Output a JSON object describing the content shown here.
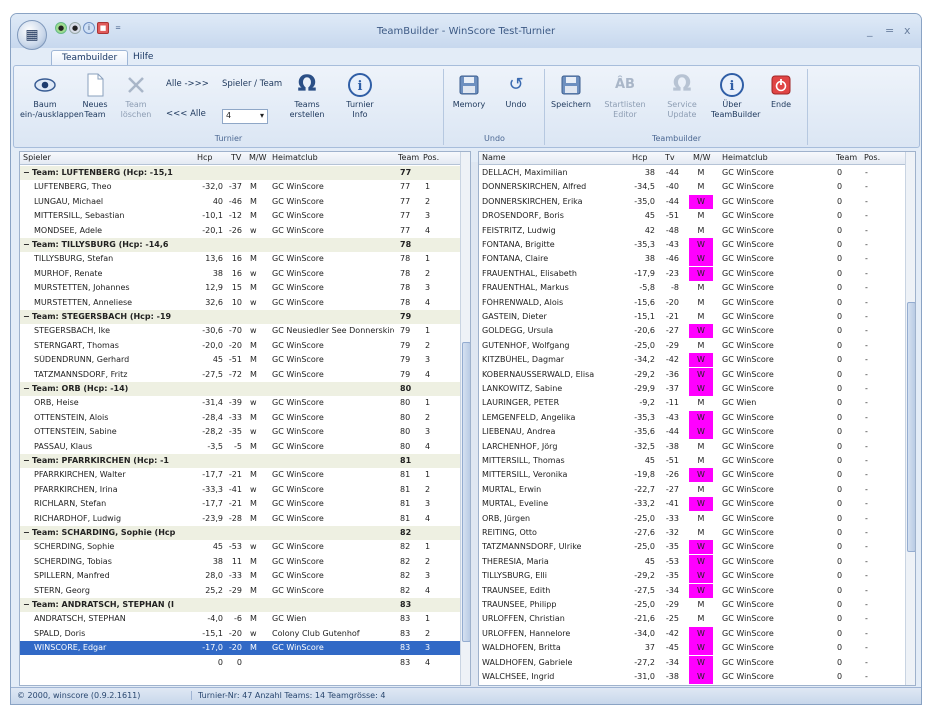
{
  "window": {
    "title": "TeamBuilder - WinScore Test-Turnier",
    "min": "_",
    "max": "=",
    "close": "x",
    "qa_drop": "="
  },
  "tabs": [
    {
      "label": "Teambuilder"
    },
    {
      "label": "Hilfe"
    }
  ],
  "ribbon": {
    "turnier": {
      "label": "Turnier",
      "baum": "Baum\nein-/ausklappen",
      "neues": "Neues\nTeam",
      "loeschen": "Team\nlöschen",
      "alle_vor": "Alle ->>>",
      "alle_zur": "<<< Alle",
      "spieler_team_label": "Spieler / Team",
      "spieler_team_value": "4",
      "teams_erstellen": "Teams\nerstellen",
      "turnier_info": "Turnier\nInfo"
    },
    "undo": {
      "label": "Undo",
      "memory": "Memory",
      "undo": "Undo"
    },
    "tb": {
      "label": "Teambuilder",
      "speichern": "Speichern",
      "startlisten": "Startlisten\nEditor",
      "service": "Service\nUpdate",
      "ueber": "Über\nTeamBuilder",
      "ende": "Ende"
    }
  },
  "left": {
    "headers": [
      "Spieler",
      "Hcp",
      "TV",
      "M/W",
      "Heimatclub",
      "Team",
      "Pos."
    ],
    "rows": [
      {
        "g": true,
        "name": "Team: LUFTENBERG (Hcp: -15,1",
        "team": "77"
      },
      {
        "name": "LUFTENBERG, Theo",
        "hcp": "-32,0",
        "tv": "-37",
        "mw": "M",
        "club": "GC WinScore",
        "team": "77",
        "pos": "1"
      },
      {
        "name": "LUNGAU, Michael",
        "hcp": "40",
        "tv": "-46",
        "mw": "M",
        "club": "GC WinScore",
        "team": "77",
        "pos": "2"
      },
      {
        "name": "MITTERSILL, Sebastian",
        "hcp": "-10,1",
        "tv": "-12",
        "mw": "M",
        "club": "GC WinScore",
        "team": "77",
        "pos": "3"
      },
      {
        "name": "MONDSEE, Adele",
        "hcp": "-20,1",
        "tv": "-26",
        "mw": "w",
        "club": "GC WinScore",
        "team": "77",
        "pos": "4"
      },
      {
        "g": true,
        "name": "Team: TILLYSBURG (Hcp: -14,6",
        "team": "78"
      },
      {
        "name": "TILLYSBURG, Stefan",
        "hcp": "13,6",
        "tv": "16",
        "mw": "M",
        "club": "GC WinScore",
        "team": "78",
        "pos": "1"
      },
      {
        "name": "MURHOF, Renate",
        "hcp": "38",
        "tv": "16",
        "mw": "w",
        "club": "GC WinScore",
        "team": "78",
        "pos": "2"
      },
      {
        "name": "MURSTETTEN, Johannes",
        "hcp": "12,9",
        "tv": "15",
        "mw": "M",
        "club": "GC WinScore",
        "team": "78",
        "pos": "3"
      },
      {
        "name": "MURSTETTEN, Anneliese",
        "hcp": "32,6",
        "tv": "10",
        "mw": "w",
        "club": "GC WinScore",
        "team": "78",
        "pos": "4"
      },
      {
        "g": true,
        "name": "Team: STEGERSBACH (Hcp: -19",
        "team": "79"
      },
      {
        "name": "STEGERSBACH, Ike",
        "hcp": "-30,6",
        "tv": "-70",
        "mw": "w",
        "club": "GC Neusiedler See Donnerskirchen",
        "team": "79",
        "pos": "1"
      },
      {
        "name": "STERNGART, Thomas",
        "hcp": "-20,0",
        "tv": "-20",
        "mw": "M",
        "club": "GC WinScore",
        "team": "79",
        "pos": "2"
      },
      {
        "name": "SÜDENDRUNN, Gerhard",
        "hcp": "45",
        "tv": "-51",
        "mw": "M",
        "club": "GC WinScore",
        "team": "79",
        "pos": "3"
      },
      {
        "name": "TATZMANNSDORF, Fritz",
        "hcp": "-27,5",
        "tv": "-72",
        "mw": "M",
        "club": "GC WinScore",
        "team": "79",
        "pos": "4"
      },
      {
        "g": true,
        "name": "Team: ORB (Hcp: -14)",
        "team": "80"
      },
      {
        "name": "ORB, Heise",
        "hcp": "-31,4",
        "tv": "-39",
        "mw": "w",
        "club": "GC WinScore",
        "team": "80",
        "pos": "1"
      },
      {
        "name": "OTTENSTEIN, Alois",
        "hcp": "-28,4",
        "tv": "-33",
        "mw": "M",
        "club": "GC WinScore",
        "team": "80",
        "pos": "2"
      },
      {
        "name": "OTTENSTEIN, Sabine",
        "hcp": "-28,2",
        "tv": "-35",
        "mw": "w",
        "club": "GC WinScore",
        "team": "80",
        "pos": "3"
      },
      {
        "name": "PASSAU, Klaus",
        "hcp": "-3,5",
        "tv": "-5",
        "mw": "M",
        "club": "GC WinScore",
        "team": "80",
        "pos": "4"
      },
      {
        "g": true,
        "name": "Team: PFARRKIRCHEN (Hcp: -1",
        "team": "81"
      },
      {
        "name": "PFARRKIRCHEN, Walter",
        "hcp": "-17,7",
        "tv": "-21",
        "mw": "M",
        "club": "GC WinScore",
        "team": "81",
        "pos": "1"
      },
      {
        "name": "PFARRKIRCHEN, Irina",
        "hcp": "-33,3",
        "tv": "-41",
        "mw": "w",
        "club": "GC WinScore",
        "team": "81",
        "pos": "2"
      },
      {
        "name": "RICHLARN, Stefan",
        "hcp": "-17,7",
        "tv": "-21",
        "mw": "M",
        "club": "GC WinScore",
        "team": "81",
        "pos": "3"
      },
      {
        "name": "RICHARDHOF, Ludwig",
        "hcp": "-23,9",
        "tv": "-28",
        "mw": "M",
        "club": "GC WinScore",
        "team": "81",
        "pos": "4"
      },
      {
        "g": true,
        "name": "Team: SCHARDING, Sophie (Hcp",
        "team": "82"
      },
      {
        "name": "SCHERDING, Sophie",
        "hcp": "45",
        "tv": "-53",
        "mw": "w",
        "club": "GC WinScore",
        "team": "82",
        "pos": "1"
      },
      {
        "name": "SCHERDING, Tobias",
        "hcp": "38",
        "tv": "11",
        "mw": "M",
        "club": "GC WinScore",
        "team": "82",
        "pos": "2"
      },
      {
        "name": "SPILLERN, Manfred",
        "hcp": "28,0",
        "tv": "-33",
        "mw": "M",
        "club": "GC WinScore",
        "team": "82",
        "pos": "3"
      },
      {
        "name": "STERN, Georg",
        "hcp": "25,2",
        "tv": "-29",
        "mw": "M",
        "club": "GC WinScore",
        "team": "82",
        "pos": "4"
      },
      {
        "g": true,
        "name": "Team: ANDRATSCH, STEPHAN (I",
        "team": "83"
      },
      {
        "name": "ANDRATSCH, STEPHAN",
        "hcp": "-4,0",
        "tv": "-6",
        "mw": "M",
        "club": "GC Wien",
        "team": "83",
        "pos": "1"
      },
      {
        "name": "SPALD, Doris",
        "hcp": "-15,1",
        "tv": "-20",
        "mw": "w",
        "club": "Colony Club Gutenhof",
        "team": "83",
        "pos": "2"
      },
      {
        "sel": true,
        "name": "WINSCORE, Edgar",
        "hcp": "-17,0",
        "tv": "-20",
        "mw": "M",
        "club": "GC WinScore",
        "team": "83",
        "pos": "3"
      },
      {
        "name": "",
        "hcp": "0",
        "tv": "0",
        "mw": "",
        "club": "",
        "team": "83",
        "pos": "4"
      }
    ]
  },
  "right": {
    "headers": [
      "Name",
      "Hcp",
      "Tv",
      "M/W",
      "Heimatclub",
      "Team",
      "Pos."
    ],
    "rows": [
      {
        "name": "DELLACH, Maximilian",
        "hcp": "38",
        "tv": "-44",
        "mw": "M",
        "club": "GC WinScore",
        "team": "0",
        "pos": "-"
      },
      {
        "name": "DONNERSKIRCHEN, Alfred",
        "hcp": "-34,5",
        "tv": "-40",
        "mw": "M",
        "club": "GC WinScore",
        "team": "0",
        "pos": "-"
      },
      {
        "name": "DONNERSKIRCHEN, Erika",
        "hcp": "-35,0",
        "tv": "-44",
        "mw": "W",
        "club": "GC WinScore",
        "team": "0",
        "pos": "-"
      },
      {
        "name": "DROSENDORF, Boris",
        "hcp": "45",
        "tv": "-51",
        "mw": "M",
        "club": "GC WinScore",
        "team": "0",
        "pos": "-"
      },
      {
        "name": "FEISTRITZ, Ludwig",
        "hcp": "42",
        "tv": "-48",
        "mw": "M",
        "club": "GC WinScore",
        "team": "0",
        "pos": "-"
      },
      {
        "name": "FONTANA, Brigitte",
        "hcp": "-35,3",
        "tv": "-43",
        "mw": "W",
        "club": "GC WinScore",
        "team": "0",
        "pos": "-"
      },
      {
        "name": "FONTANA, Claire",
        "hcp": "38",
        "tv": "-46",
        "mw": "W",
        "club": "GC WinScore",
        "team": "0",
        "pos": "-"
      },
      {
        "name": "FRAUENTHAL, Elisabeth",
        "hcp": "-17,9",
        "tv": "-23",
        "mw": "W",
        "club": "GC WinScore",
        "team": "0",
        "pos": "-"
      },
      {
        "name": "FRAUENTHAL, Markus",
        "hcp": "-5,8",
        "tv": "-8",
        "mw": "M",
        "club": "GC WinScore",
        "team": "0",
        "pos": "-"
      },
      {
        "name": "FÖHRENWALD, Alois",
        "hcp": "-15,6",
        "tv": "-20",
        "mw": "M",
        "club": "GC WinScore",
        "team": "0",
        "pos": "-"
      },
      {
        "name": "GASTEIN, Dieter",
        "hcp": "-15,1",
        "tv": "-21",
        "mw": "M",
        "club": "GC WinScore",
        "team": "0",
        "pos": "-"
      },
      {
        "name": "GOLDEGG, Ursula",
        "hcp": "-20,6",
        "tv": "-27",
        "mw": "W",
        "club": "GC WinScore",
        "team": "0",
        "pos": "-"
      },
      {
        "name": "GUTENHOF, Wolfgang",
        "hcp": "-25,0",
        "tv": "-29",
        "mw": "M",
        "club": "GC WinScore",
        "team": "0",
        "pos": "-"
      },
      {
        "name": "KITZBÜHEL, Dagmar",
        "hcp": "-34,2",
        "tv": "-42",
        "mw": "W",
        "club": "GC WinScore",
        "team": "0",
        "pos": "-"
      },
      {
        "name": "KOBERNAUSSERWALD, Elisa",
        "hcp": "-29,2",
        "tv": "-36",
        "mw": "W",
        "club": "GC WinScore",
        "team": "0",
        "pos": "-"
      },
      {
        "name": "LANKOWITZ, Sabine",
        "hcp": "-29,9",
        "tv": "-37",
        "mw": "W",
        "club": "GC WinScore",
        "team": "0",
        "pos": "-"
      },
      {
        "name": "LAURINGER, PETER",
        "hcp": "-9,2",
        "tv": "-11",
        "mw": "M",
        "club": "GC Wien",
        "team": "0",
        "pos": "-"
      },
      {
        "name": "LEMGENFELD, Angelika",
        "hcp": "-35,3",
        "tv": "-43",
        "mw": "W",
        "club": "GC WinScore",
        "team": "0",
        "pos": "-"
      },
      {
        "name": "LIEBENAU, Andrea",
        "hcp": "-35,6",
        "tv": "-44",
        "mw": "W",
        "club": "GC WinScore",
        "team": "0",
        "pos": "-"
      },
      {
        "name": "LARCHENHOF, Jörg",
        "hcp": "-32,5",
        "tv": "-38",
        "mw": "M",
        "club": "GC WinScore",
        "team": "0",
        "pos": "-"
      },
      {
        "name": "MITTERSILL, Thomas",
        "hcp": "45",
        "tv": "-51",
        "mw": "M",
        "club": "GC WinScore",
        "team": "0",
        "pos": "-"
      },
      {
        "name": "MITTERSILL, Veronika",
        "hcp": "-19,8",
        "tv": "-26",
        "mw": "W",
        "club": "GC WinScore",
        "team": "0",
        "pos": "-"
      },
      {
        "name": "MURTAL, Erwin",
        "hcp": "-22,7",
        "tv": "-27",
        "mw": "M",
        "club": "GC WinScore",
        "team": "0",
        "pos": "-"
      },
      {
        "name": "MURTAL, Eveline",
        "hcp": "-33,2",
        "tv": "-41",
        "mw": "W",
        "club": "GC WinScore",
        "team": "0",
        "pos": "-"
      },
      {
        "name": "ORB, Jürgen",
        "hcp": "-25,0",
        "tv": "-33",
        "mw": "M",
        "club": "GC WinScore",
        "team": "0",
        "pos": "-"
      },
      {
        "name": "REITING, Otto",
        "hcp": "-27,6",
        "tv": "-32",
        "mw": "M",
        "club": "GC WinScore",
        "team": "0",
        "pos": "-"
      },
      {
        "name": "TATZMANNSDORF, Ulrike",
        "hcp": "-25,0",
        "tv": "-35",
        "mw": "W",
        "club": "GC WinScore",
        "team": "0",
        "pos": "-"
      },
      {
        "name": "THERESIA, Maria",
        "hcp": "45",
        "tv": "-53",
        "mw": "W",
        "club": "GC WinScore",
        "team": "0",
        "pos": "-"
      },
      {
        "name": "TILLYSBURG, Elli",
        "hcp": "-29,2",
        "tv": "-35",
        "mw": "W",
        "club": "GC WinScore",
        "team": "0",
        "pos": "-"
      },
      {
        "name": "TRAUNSEE, Edith",
        "hcp": "-27,5",
        "tv": "-34",
        "mw": "W",
        "club": "GC WinScore",
        "team": "0",
        "pos": "-"
      },
      {
        "name": "TRAUNSEE, Philipp",
        "hcp": "-25,0",
        "tv": "-29",
        "mw": "M",
        "club": "GC WinScore",
        "team": "0",
        "pos": "-"
      },
      {
        "name": "URLOFFEN, Christian",
        "hcp": "-21,6",
        "tv": "-25",
        "mw": "M",
        "club": "GC WinScore",
        "team": "0",
        "pos": "-"
      },
      {
        "name": "URLOFFEN, Hannelore",
        "hcp": "-34,0",
        "tv": "-42",
        "mw": "W",
        "club": "GC WinScore",
        "team": "0",
        "pos": "-"
      },
      {
        "name": "WALDHOFEN, Britta",
        "hcp": "37",
        "tv": "-45",
        "mw": "W",
        "club": "GC WinScore",
        "team": "0",
        "pos": "-"
      },
      {
        "name": "WALDHOFEN, Gabriele",
        "hcp": "-27,2",
        "tv": "-34",
        "mw": "W",
        "club": "GC WinScore",
        "team": "0",
        "pos": "-"
      },
      {
        "name": "WALCHSEE, Ingrid",
        "hcp": "-31,0",
        "tv": "-38",
        "mw": "W",
        "club": "GC WinScore",
        "team": "0",
        "pos": "-"
      }
    ]
  },
  "status": {
    "copyright": "© 2000, winscore (0.9.2.1611)",
    "info": "Turnier-Nr: 47  Anzahl Teams: 14  Teamgrösse: 4"
  },
  "colors": {
    "accent": "#3169c6",
    "women": "#ff00ff",
    "group": "#eef0e2"
  }
}
